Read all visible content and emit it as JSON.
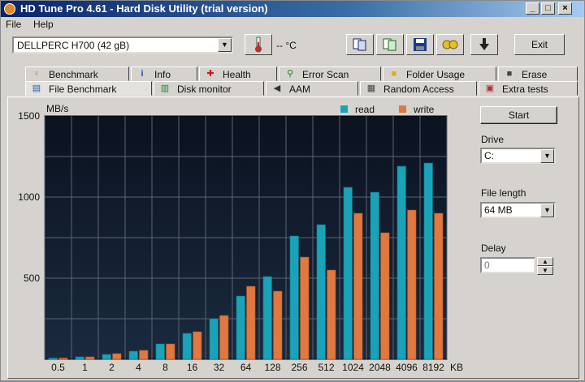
{
  "window": {
    "title": "HD Tune Pro 4.61 - Hard Disk Utility (trial version)",
    "controls": [
      "_",
      "□",
      "×"
    ]
  },
  "menu": [
    "File",
    "Help"
  ],
  "toolbar": {
    "drive": "DELLPERC H700 (42 gB)",
    "temperature": "-- °C",
    "exit_label": "Exit",
    "icons": [
      "thermometer-icon",
      "copy-icon",
      "copy-info-icon",
      "save-icon",
      "options-icon",
      "download-icon"
    ]
  },
  "tabs_back": [
    {
      "label": "Benchmark",
      "icon": "benchmark-icon",
      "glyph": "♀"
    },
    {
      "label": "Info",
      "icon": "info-icon",
      "glyph": "i"
    },
    {
      "label": "Health",
      "icon": "health-icon",
      "glyph": "✚"
    },
    {
      "label": "Error Scan",
      "icon": "magnifier-icon",
      "glyph": "🔍"
    },
    {
      "label": "Folder Usage",
      "icon": "folder-icon",
      "glyph": "▬"
    },
    {
      "label": "Erase",
      "icon": "trash-icon",
      "glyph": "▮"
    }
  ],
  "tabs_front": [
    {
      "label": "File Benchmark",
      "icon": "file-benchmark-icon",
      "glyph": "▤",
      "active": true
    },
    {
      "label": "Disk monitor",
      "icon": "monitor-icon",
      "glyph": "▥"
    },
    {
      "label": "AAM",
      "icon": "speaker-icon",
      "glyph": "◀"
    },
    {
      "label": "Random Access",
      "icon": "random-access-icon",
      "glyph": "▦"
    },
    {
      "label": "Extra tests",
      "icon": "extra-tests-icon",
      "glyph": "▣"
    }
  ],
  "side": {
    "start_label": "Start",
    "drive_label": "Drive",
    "drive_value": "C:",
    "file_length_label": "File length",
    "file_length_value": "64 MB",
    "delay_label": "Delay",
    "delay_value": "0"
  },
  "colors": {
    "read": "#1aa3b8",
    "write": "#e07840"
  },
  "chart_data": {
    "type": "bar",
    "ylabel": "MB/s",
    "ylim": [
      0,
      1500
    ],
    "yticks": [
      1500,
      1000,
      500
    ],
    "x_unit": "KB",
    "categories": [
      "0.5",
      "1",
      "2",
      "4",
      "8",
      "16",
      "32",
      "64",
      "128",
      "256",
      "512",
      "1024",
      "2048",
      "4096",
      "8192"
    ],
    "series": [
      {
        "name": "read",
        "values": [
          8,
          15,
          30,
          50,
          95,
          160,
          250,
          390,
          510,
          760,
          830,
          1060,
          1030,
          1190,
          1210
        ]
      },
      {
        "name": "write",
        "values": [
          8,
          15,
          35,
          55,
          95,
          170,
          270,
          450,
          420,
          630,
          550,
          900,
          780,
          920,
          900
        ]
      }
    ],
    "grid": true,
    "legend": "top-right"
  }
}
